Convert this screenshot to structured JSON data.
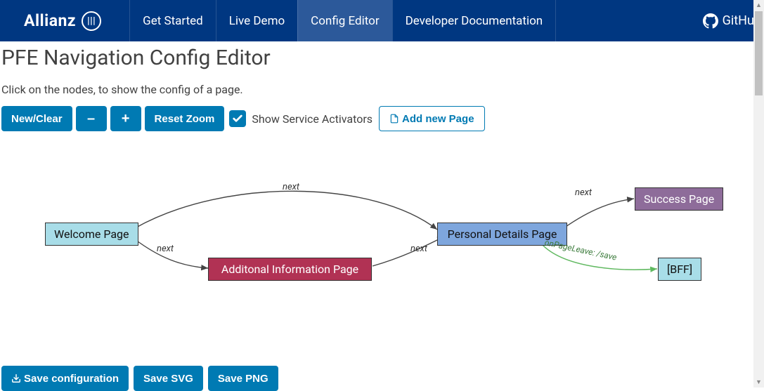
{
  "header": {
    "logo_text": "Allianz",
    "nav": [
      {
        "label": "Get Started",
        "active": false
      },
      {
        "label": "Live Demo",
        "active": false
      },
      {
        "label": "Config Editor",
        "active": true
      },
      {
        "label": "Developer Documentation",
        "active": false
      }
    ],
    "github_label": "GitHub"
  },
  "page": {
    "title": "PFE Navigation Config Editor",
    "subtitle": "Click on the nodes, to show the config of a page."
  },
  "toolbar": {
    "new_clear": "New/Clear",
    "zoom_out": "–",
    "zoom_in": "+",
    "reset_zoom": "Reset Zoom",
    "show_activators_label": "Show Service Activators",
    "show_activators_checked": true,
    "add_page": "Add new Page"
  },
  "graph": {
    "nodes": {
      "welcome": "Welcome Page",
      "additional": "Additonal Information Page",
      "personal": "Personal Details Page",
      "success": "Success Page",
      "bff": "[BFF]"
    },
    "edges": {
      "e1": "next",
      "e2": "next",
      "e3": "next",
      "e4": "next",
      "e5": "onPageLeave: /save"
    }
  },
  "footer": {
    "save_config": "Save configuration",
    "save_svg": "Save SVG",
    "save_png": "Save PNG"
  }
}
